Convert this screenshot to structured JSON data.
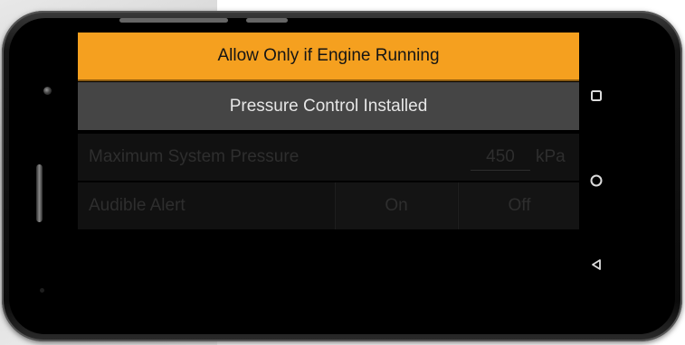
{
  "screen": {
    "primary_button_label": "Allow Only if Engine Running",
    "secondary_button_label": "Pressure Control Installed",
    "pressure_row": {
      "label": "Maximum System Pressure",
      "value": "450",
      "unit": "kPa"
    },
    "alert_row": {
      "label": "Audible Alert",
      "on_label": "On",
      "off_label": "Off"
    }
  },
  "nav_bar": {
    "icons": [
      "recent-apps-icon",
      "home-icon",
      "back-icon"
    ]
  },
  "colors": {
    "accent": "#f5a01f",
    "secondary_button": "#454545",
    "disabled_text": "#2e2e2e"
  }
}
